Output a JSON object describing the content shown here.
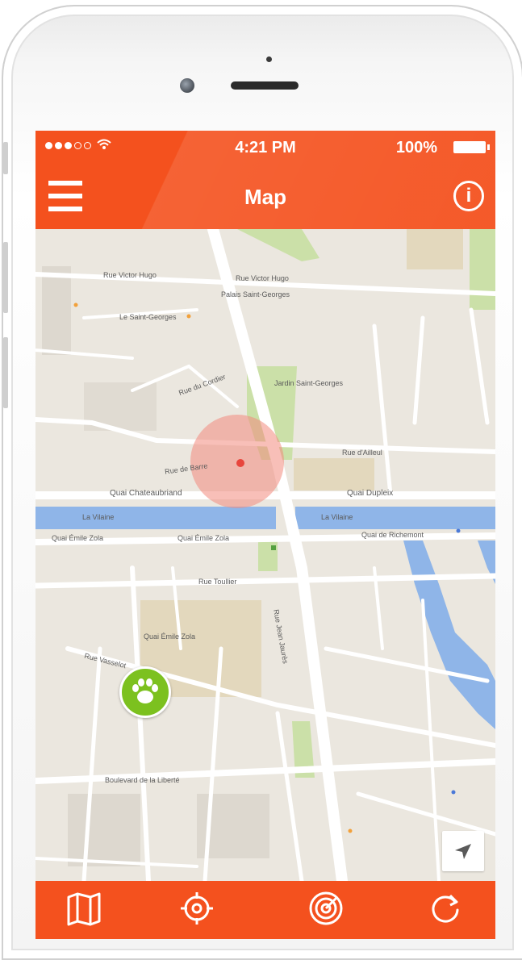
{
  "status_bar": {
    "time": "4:21 PM",
    "battery": "100%"
  },
  "nav": {
    "title": "Map",
    "menu_icon": "hamburger-menu-icon",
    "info_icon": "info-icon"
  },
  "map": {
    "labels": [
      "Rue Victor Hugo",
      "Rue Victor Hugo",
      "Rue du Cordier",
      "Jardin Saint-Georges",
      "Rue d'Ailleul",
      "Rue de Barre",
      "Quai Chateaubriand",
      "Quai Dupleix",
      "La Vilaine",
      "La Vilaine",
      "Quai Émile Zola",
      "Quai Émile Zola",
      "Rue Toullier",
      "Quai Émile Zola",
      "Quai de Richemont",
      "Rue Vasselot",
      "Boulevard de la Liberté",
      "Rue Jean Jaurès",
      "Palais Saint-Georges",
      "Le Saint-Georges"
    ],
    "accuracy_circle_color": "#f28b7d",
    "pet_marker_color": "#7cc11f",
    "locate_icon": "navigation-arrow-icon"
  },
  "tabbar": {
    "tabs": [
      {
        "icon": "map-icon"
      },
      {
        "icon": "target-locate-icon"
      },
      {
        "icon": "radar-icon"
      },
      {
        "icon": "refresh-icon"
      }
    ]
  },
  "colors": {
    "accent": "#f4511e",
    "river": "#8fb5e8",
    "park": "#cbe0a8"
  }
}
